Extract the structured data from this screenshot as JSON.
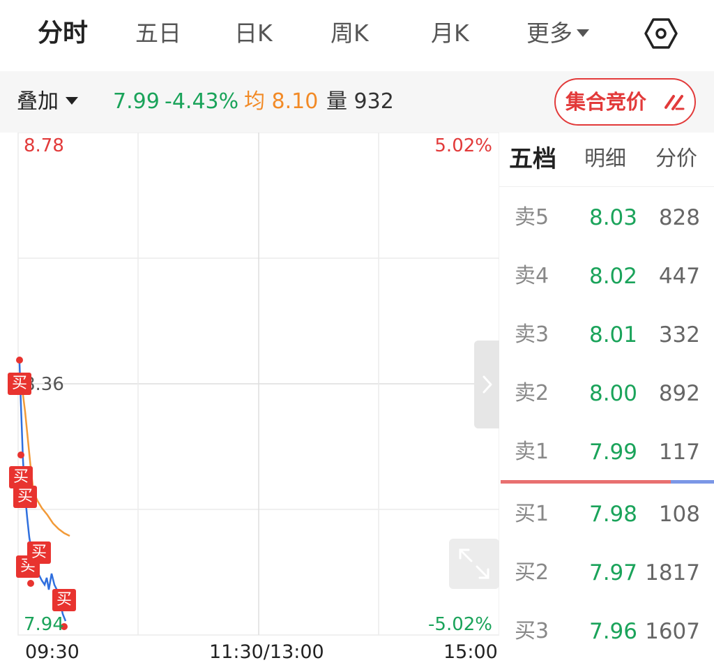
{
  "tabs": [
    {
      "label": "分时"
    },
    {
      "label": "五日"
    },
    {
      "label": "日K"
    },
    {
      "label": "周K"
    },
    {
      "label": "月K"
    },
    {
      "label": "更多"
    }
  ],
  "info": {
    "overlay_label": "叠加",
    "price": "7.99",
    "change_pct": "-4.43%",
    "avg_label": "均",
    "avg_value": "8.10",
    "volume_label": "量",
    "volume_value": "932",
    "auction_button": "集合竞价"
  },
  "chart": {
    "price_top": "8.78",
    "price_mid": "8.36",
    "price_bottom": "7.94",
    "pct_top": "5.02%",
    "pct_bottom": "-5.02%",
    "time_start": "09:30",
    "time_mid": "11:30/13:00",
    "time_end": "15:00",
    "buy_marker_label": "买",
    "colors": {
      "price_line": "#2f6fde",
      "avg_line": "#f29a38",
      "up": "#e23a3a",
      "down": "#1aa35a"
    }
  },
  "book": {
    "tabs": [
      {
        "label": "五档"
      },
      {
        "label": "明细"
      },
      {
        "label": "分价"
      }
    ],
    "sell": [
      {
        "label": "卖5",
        "price": "8.03",
        "volume": "828"
      },
      {
        "label": "卖4",
        "price": "8.02",
        "volume": "447"
      },
      {
        "label": "卖3",
        "price": "8.01",
        "volume": "332"
      },
      {
        "label": "卖2",
        "price": "8.00",
        "volume": "892"
      },
      {
        "label": "卖1",
        "price": "7.99",
        "volume": "117"
      }
    ],
    "buy": [
      {
        "label": "买1",
        "price": "7.98",
        "volume": "108"
      },
      {
        "label": "买2",
        "price": "7.97",
        "volume": "1817"
      },
      {
        "label": "买3",
        "price": "7.96",
        "volume": "1607"
      }
    ]
  }
}
